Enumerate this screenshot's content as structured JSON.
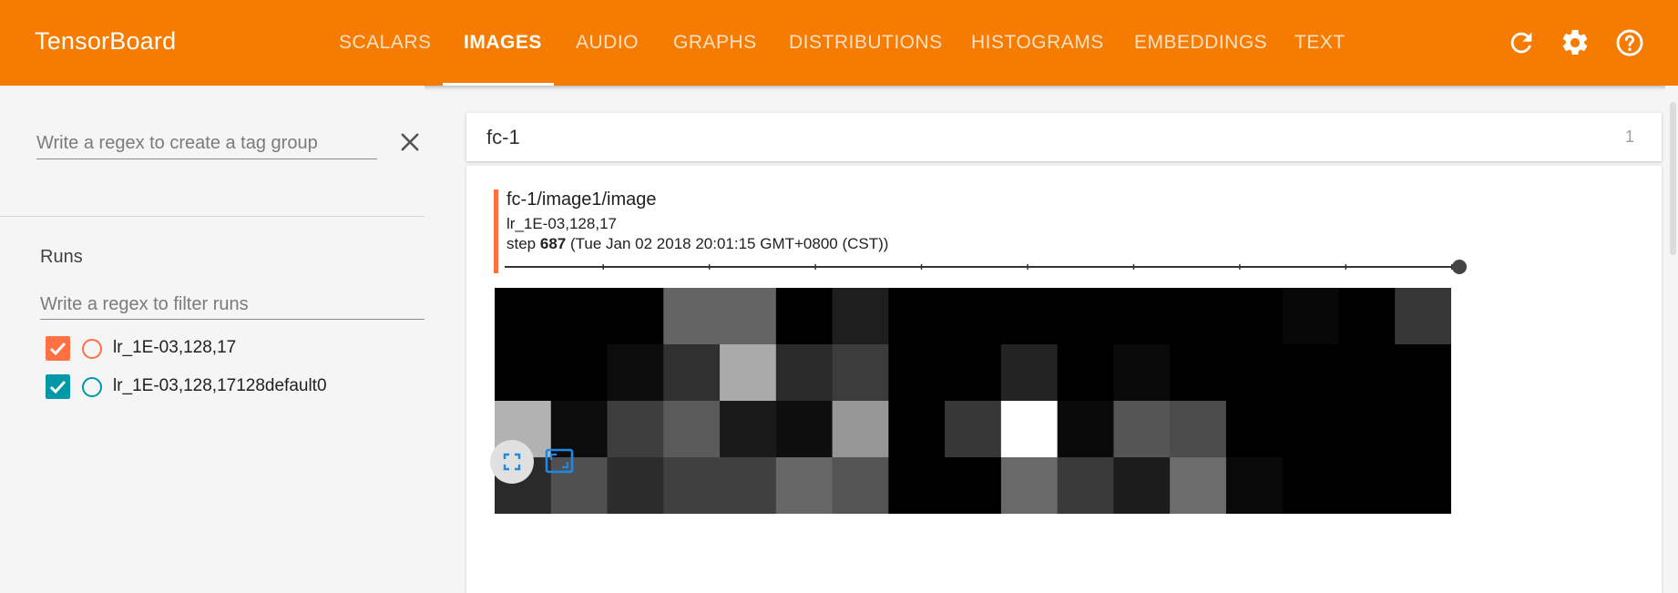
{
  "app": {
    "title": "TensorBoard"
  },
  "nav": {
    "tabs": [
      {
        "label": "SCALARS",
        "active": false
      },
      {
        "label": "IMAGES",
        "active": true
      },
      {
        "label": "AUDIO",
        "active": false
      },
      {
        "label": "GRAPHS",
        "active": false
      },
      {
        "label": "DISTRIBUTIONS",
        "active": false
      },
      {
        "label": "HISTOGRAMS",
        "active": false
      },
      {
        "label": "EMBEDDINGS",
        "active": false
      },
      {
        "label": "TEXT",
        "active": false
      }
    ],
    "icons": [
      "refresh-icon",
      "settings-gear-icon",
      "help-icon"
    ]
  },
  "colors": {
    "toolbar": "#f57c00",
    "run_0": "#ff7043",
    "run_1": "#0097a7",
    "accent_icon": "#1e88e5"
  },
  "sidebar": {
    "tag_group_placeholder": "Write a regex to create a tag group",
    "runs_label": "Runs",
    "run_filter_placeholder": "Write a regex to filter runs",
    "runs": [
      {
        "name": "lr_1E-03,128,17",
        "checked": true
      },
      {
        "name": "lr_1E-03,128,17128default0",
        "checked": true
      }
    ]
  },
  "main": {
    "group": {
      "title": "fc-1",
      "count": "1"
    },
    "card": {
      "tag": "fc-1/image1/image",
      "run": "lr_1E-03,128,17",
      "step_prefix": "step",
      "step": "687",
      "timestamp": "(Tue Jan 02 2018 20:01:15 GMT+0800 (CST))",
      "step_slider_value": 1.0,
      "step_slider_ticks": 9,
      "image_grid": {
        "rows": 4,
        "cols": 17,
        "gray_levels": [
          [
            0,
            0,
            0,
            100,
            100,
            0,
            30,
            0,
            0,
            0,
            0,
            0,
            0,
            0,
            8,
            0,
            55
          ],
          [
            0,
            0,
            12,
            48,
            170,
            42,
            60,
            0,
            0,
            35,
            0,
            10,
            0,
            0,
            0,
            0,
            0
          ],
          [
            178,
            12,
            62,
            90,
            26,
            14,
            150,
            0,
            55,
            255,
            10,
            85,
            75,
            0,
            0,
            0,
            0
          ],
          [
            42,
            80,
            44,
            64,
            64,
            102,
            84,
            0,
            0,
            105,
            58,
            28,
            108,
            10,
            0,
            0,
            0
          ]
        ]
      },
      "actions": [
        "fit-to-screen-icon",
        "actual-size-icon"
      ]
    }
  }
}
